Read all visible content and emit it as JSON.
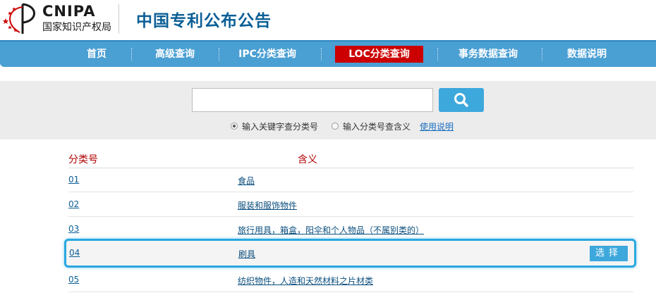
{
  "header": {
    "logo_en": "CNIPA",
    "logo_cn": "国家知识产权局",
    "site_title": "中国专利公布公告"
  },
  "nav": {
    "items": [
      {
        "label": "首页"
      },
      {
        "label": "高级查询"
      },
      {
        "label": "IPC分类查询"
      },
      {
        "label": "LOC分类查询"
      },
      {
        "label": "事务数据查询"
      },
      {
        "label": "数据说明"
      }
    ],
    "active": "LOC分类查询"
  },
  "search": {
    "value": "",
    "button_icon": "search-icon",
    "options": [
      {
        "label": "输入关键字查分类号",
        "checked": true
      },
      {
        "label": "输入分类号查含义",
        "checked": false
      }
    ],
    "help_label": "使用说明"
  },
  "table": {
    "headers": {
      "code": "分类号",
      "meaning": "含义"
    },
    "rows": [
      {
        "code": "01",
        "meaning": "食品"
      },
      {
        "code": "02",
        "meaning": "服装和服饰物件"
      },
      {
        "code": "03",
        "meaning": "旅行用具，箱盒，阳伞和个人物品（不属别类的）"
      },
      {
        "code": "04",
        "meaning": "刷具",
        "selected": true
      },
      {
        "code": "05",
        "meaning": "纺织物件，人造和天然材料之片材类"
      }
    ],
    "select_label": "选择"
  },
  "colors": {
    "brand_blue": "#0b5f96",
    "nav_blue": "#4a9fd3",
    "active_red": "#cc0000",
    "header_red": "#b00000",
    "highlight": "#29a8df"
  }
}
